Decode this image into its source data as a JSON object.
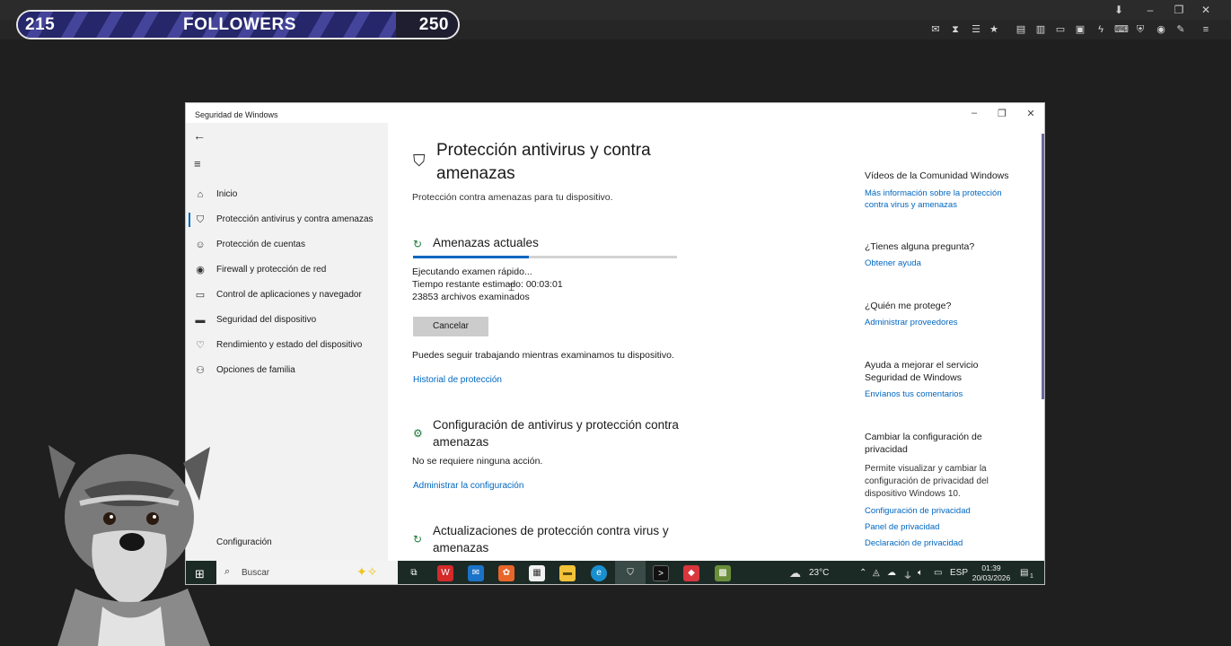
{
  "followers": {
    "current": "215",
    "label": "FOLLOWERS",
    "goal": "250",
    "progress_fraction": 0.86
  },
  "window": {
    "title": "Seguridad de Windows",
    "nav": {
      "items": [
        {
          "label": "Inicio",
          "icon": "home-icon"
        },
        {
          "label": "Protección antivirus y contra amenazas",
          "icon": "shield-icon",
          "active": true
        },
        {
          "label": "Protección de cuentas",
          "icon": "person-icon"
        },
        {
          "label": "Firewall y protección de red",
          "icon": "wifi-icon"
        },
        {
          "label": "Control de aplicaciones y navegador",
          "icon": "browser-icon"
        },
        {
          "label": "Seguridad del dispositivo",
          "icon": "laptop-icon"
        },
        {
          "label": "Rendimiento y estado del dispositivo",
          "icon": "heart-icon"
        },
        {
          "label": "Opciones de familia",
          "icon": "family-icon"
        }
      ],
      "settings_label": "Configuración"
    },
    "main": {
      "title": "Protección antivirus y contra amenazas",
      "subtitle": "Protección contra amenazas para tu dispositivo.",
      "current_threats": {
        "heading": "Amenazas actuales",
        "scan_progress_fraction": 0.44,
        "status_line": "Ejecutando examen rápido...",
        "time_line": "Tiempo restante estimado: 00:03:01",
        "files_line": "23853  archivos examinados",
        "cancel_label": "Cancelar",
        "keep_working": "Puedes seguir trabajando mientras examinamos tu dispositivo.",
        "history_link": "Historial de protección"
      },
      "settings_section": {
        "heading": "Configuración de antivirus y protección contra amenazas",
        "status": "No se requiere ninguna acción.",
        "link": "Administrar la configuración"
      },
      "updates_section": {
        "heading": "Actualizaciones de protección contra virus y amenazas"
      }
    },
    "side": {
      "community_heading": "Vídeos de la Comunidad Windows",
      "community_link": "Más información sobre la protección contra virus y amenazas",
      "question_heading": "¿Tienes alguna pregunta?",
      "help_link": "Obtener ayuda",
      "who_heading": "¿Quién me protege?",
      "providers_link": "Administrar proveedores",
      "improve_heading": "Ayuda a mejorar el servicio Seguridad de Windows",
      "feedback_link": "Envíanos tus comentarios",
      "privacy_heading": "Cambiar la configuración de privacidad",
      "privacy_text": "Permite visualizar y cambiar la configuración de privacidad del dispositivo Windows 10.",
      "privacy_links": [
        "Configuración de privacidad",
        "Panel de privacidad",
        "Declaración de privacidad"
      ]
    }
  },
  "taskbar": {
    "search_placeholder": "Buscar",
    "temperature": "23°C",
    "language": "ESP",
    "time": "01:39",
    "date": "20/03/2026",
    "notifications": "1"
  }
}
